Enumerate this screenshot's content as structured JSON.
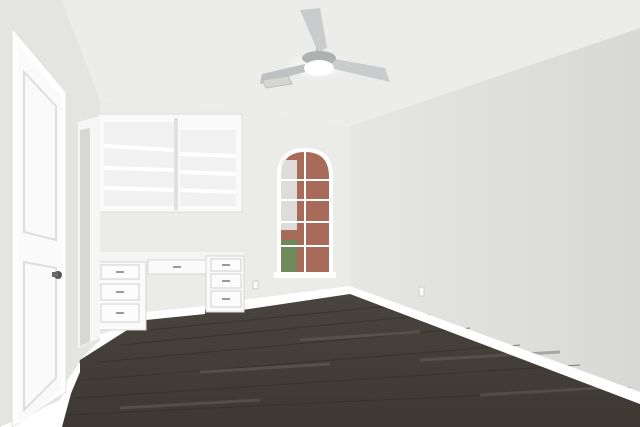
{
  "colors": {
    "ceiling": "#ececea",
    "wall_left": "#e4e4e2",
    "wall_back": "#ebebe9",
    "wall_right": "#e6e6e4",
    "floor": "#3e3833",
    "floor_light": "#5b5550",
    "trim": "#ffffff",
    "cabinet": "#fafafa",
    "cabinet_shadow": "#dcdcdc",
    "brick": "#a86b5a",
    "glass_sky": "#e8eef2",
    "fan_blade": "#c9cbcd",
    "fan_light": "#ffffff",
    "hardware": "#555555"
  }
}
